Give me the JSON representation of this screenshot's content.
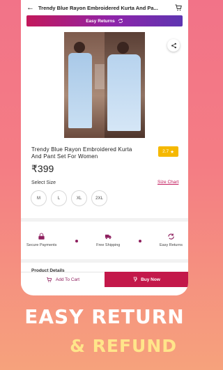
{
  "header": {
    "title": "Trendy Blue Rayon Embroidered Kurta And Pa...",
    "back_icon": "back-arrow-icon",
    "cart_icon": "cart-icon"
  },
  "banner": {
    "label": "Easy Returns",
    "icon": "return-cycle-icon"
  },
  "product": {
    "title": "Trendy Blue Rayon Embroidered Kurta And Pant Set For Women",
    "rating": "2.7",
    "price": "₹399",
    "select_size_label": "Select Size",
    "size_chart_label": "Size Chart",
    "sizes": [
      "M",
      "L",
      "XL",
      "2XL"
    ]
  },
  "features": [
    {
      "label": "Secure Payments",
      "icon": "secure-payment-icon"
    },
    {
      "label": "Free Shipping",
      "icon": "truck-icon"
    },
    {
      "label": "Easy Returns",
      "icon": "return-cycle-icon"
    }
  ],
  "details_label": "Product Details",
  "actions": {
    "add_to_cart": "Add To Cart",
    "buy_now": "Buy Now"
  },
  "promo": {
    "line1": "EASY RETURN",
    "line2": "& REFUND"
  },
  "colors": {
    "accent": "#c3184a",
    "brand_purple": "#8e1f5e",
    "rating": "#f5b800",
    "promo_yellow": "#ffe58a"
  }
}
